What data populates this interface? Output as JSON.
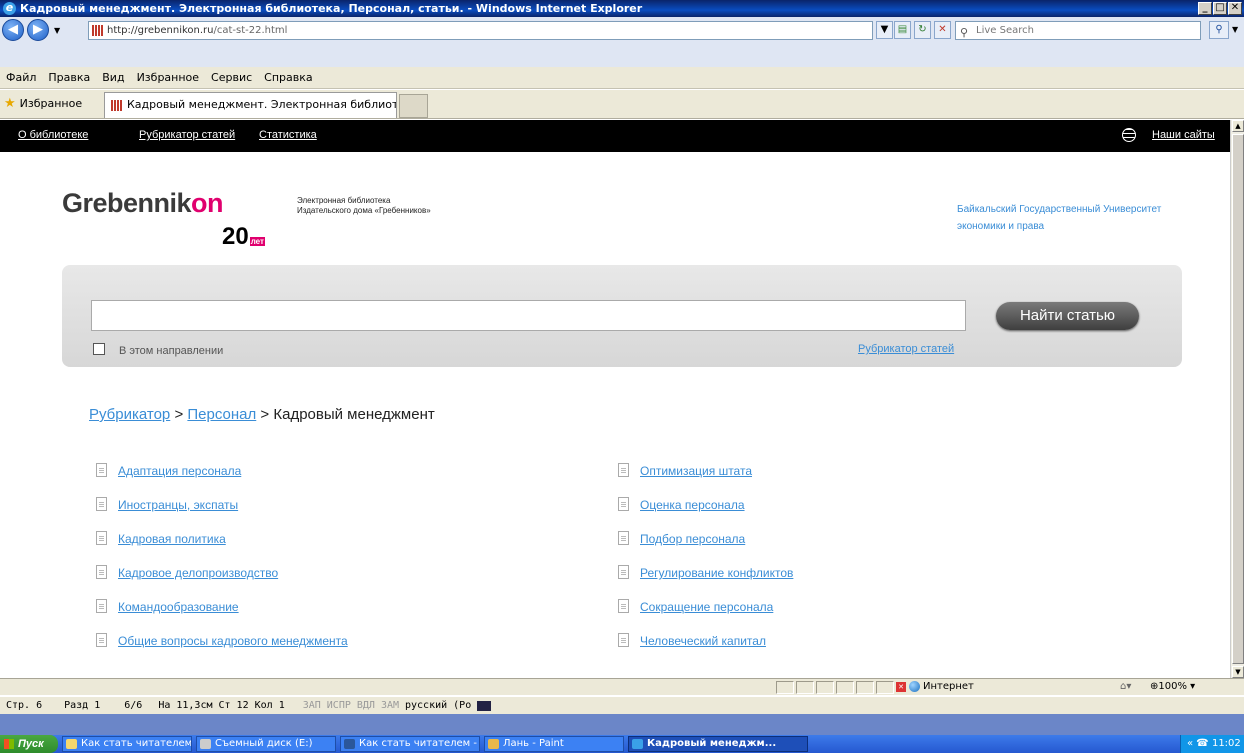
{
  "window": {
    "title": "Кадровый менеджмент. Электронная библиотека, Персонал, статьи. - Windows Internet Explorer",
    "controls": [
      "_",
      "□",
      "✕"
    ]
  },
  "toolbar": {
    "url_host": "http://grebennikon.ru",
    "url_path": "/cat-st-22.html",
    "search_placeholder": "Live Search"
  },
  "menu": [
    "Файл",
    "Правка",
    "Вид",
    "Избранное",
    "Сервис",
    "Справка"
  ],
  "favorites": {
    "label": "Избранное",
    "tab_title": "Кадровый менеджмент. Электронная библиотека,..."
  },
  "site_nav": {
    "links": [
      "О библиотеке",
      "Рубрикатор статей",
      "Статистика"
    ],
    "our_sites": "Наши сайты"
  },
  "logo": {
    "name_main": "Grebennik",
    "name_accent": "on",
    "anniversary": "20",
    "anniversary_suffix": "лет",
    "desc_line1": "Электронная библиотека",
    "desc_line2": "Издательского дома «Гребенников»"
  },
  "university": {
    "line1": "Байкальский Государственный Университет",
    "line2": "экономики и права"
  },
  "search_panel": {
    "button": "Найти статью",
    "checkbox_label": "В этом направлении",
    "rubricator_link": "Рубрикатор статей"
  },
  "breadcrumb": {
    "root": "Рубрикатор",
    "sep1": " > ",
    "section": "Персонал",
    "sep2": " > ",
    "current": "Кадровый менеджмент"
  },
  "categories_left": [
    "Адаптация персонала",
    "Иностранцы, экспаты",
    "Кадровая политика",
    "Кадровое делопроизводство",
    "Командообразование",
    "Общие вопросы кадрового менеджмента"
  ],
  "categories_right": [
    "Оптимизация штата",
    "Оценка персонала",
    "Подбор персонала",
    "Регулирование конфликтов",
    "Сокращение персонала",
    "Человеческий капитал"
  ],
  "ie_status": {
    "zone": "Интернет",
    "zoom": "100%"
  },
  "word_status": {
    "page": "Стр. 6",
    "section": "Разд 1",
    "pages": "6/6",
    "pos": "На 11,3см",
    "line": "Ст 12",
    "col": "Кол 1",
    "rec": "ЗАП",
    "trk": "ИСПР",
    "ext": "ВДЛ",
    "ovr": "ЗАМ",
    "lang": "русский (Ро"
  },
  "taskbar": {
    "start": "Пуск",
    "tasks": [
      "Как стать читателем",
      "Съемный диск (E:)",
      "Как стать читателем - ...",
      "Лань - Paint",
      "Кадровый менеджм..."
    ],
    "clock": "11:02"
  },
  "colors": {
    "link": "#3a8dd6",
    "accent": "#e0006e",
    "nav_bg": "#000000"
  }
}
